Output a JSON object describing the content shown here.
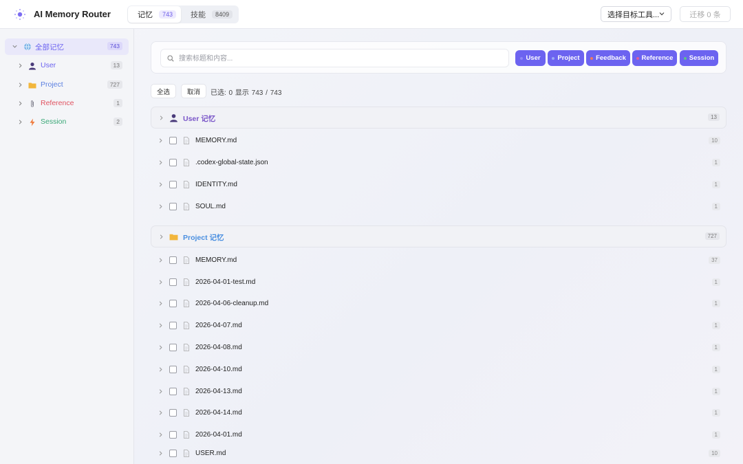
{
  "app": {
    "title": "AI Memory Router"
  },
  "tabs": [
    {
      "label": "记忆",
      "count": "743",
      "active": true
    },
    {
      "label": "技能",
      "count": "8409",
      "active": false
    }
  ],
  "header": {
    "target_select": "选择目标工具...",
    "migrate_button": "迁移 0 条"
  },
  "sidebar": {
    "items": [
      {
        "label": "全部记忆",
        "count": "743",
        "icon": "globe-icon",
        "color": "#6c63f0",
        "expanded": true,
        "active": true
      },
      {
        "label": "User",
        "count": "13",
        "icon": "user-icon",
        "color": "#6c63f0"
      },
      {
        "label": "Project",
        "count": "727",
        "icon": "folder-icon",
        "color": "#5b7fe0"
      },
      {
        "label": "Reference",
        "count": "1",
        "icon": "paperclip-icon",
        "color": "#e05260"
      },
      {
        "label": "Session",
        "count": "2",
        "icon": "lightning-icon",
        "color": "#3aa877"
      }
    ]
  },
  "search": {
    "placeholder": "搜索标题和内容...",
    "value": ""
  },
  "filters": [
    {
      "label": "User",
      "dot_color": "#6c63f0"
    },
    {
      "label": "Project",
      "dot_color": "#7a8cf0"
    },
    {
      "label": "Feedback",
      "dot_color": "#f07a5c"
    },
    {
      "label": "Reference",
      "dot_color": "#e05b9a"
    },
    {
      "label": "Session",
      "dot_color": "#5cc08a"
    }
  ],
  "toolbar": {
    "select_all": "全选",
    "cancel": "取消",
    "selected_info": "已选: 0  显示 743 / 743"
  },
  "groups": [
    {
      "label": "User 记忆",
      "count": "13",
      "icon": "user-icon",
      "color": "#7a56c8",
      "rows": [
        {
          "name": "MEMORY.md",
          "count": "10"
        },
        {
          "name": ".codex-global-state.json",
          "count": "1"
        },
        {
          "name": "IDENTITY.md",
          "count": "1"
        },
        {
          "name": "SOUL.md",
          "count": "1"
        }
      ]
    },
    {
      "label": "Project 记忆",
      "count": "727",
      "icon": "folder-icon",
      "color": "#4a8fe0",
      "rows": [
        {
          "name": "MEMORY.md",
          "count": "37"
        },
        {
          "name": "2026-04-01-test.md",
          "count": "1"
        },
        {
          "name": "2026-04-06-cleanup.md",
          "count": "1"
        },
        {
          "name": "2026-04-07.md",
          "count": "1"
        },
        {
          "name": "2026-04-08.md",
          "count": "1"
        },
        {
          "name": "2026-04-10.md",
          "count": "1"
        },
        {
          "name": "2026-04-13.md",
          "count": "1"
        },
        {
          "name": "2026-04-14.md",
          "count": "1"
        },
        {
          "name": "2026-04-01.md",
          "count": "1"
        },
        {
          "name": "USER.md",
          "count": "10"
        }
      ]
    }
  ]
}
